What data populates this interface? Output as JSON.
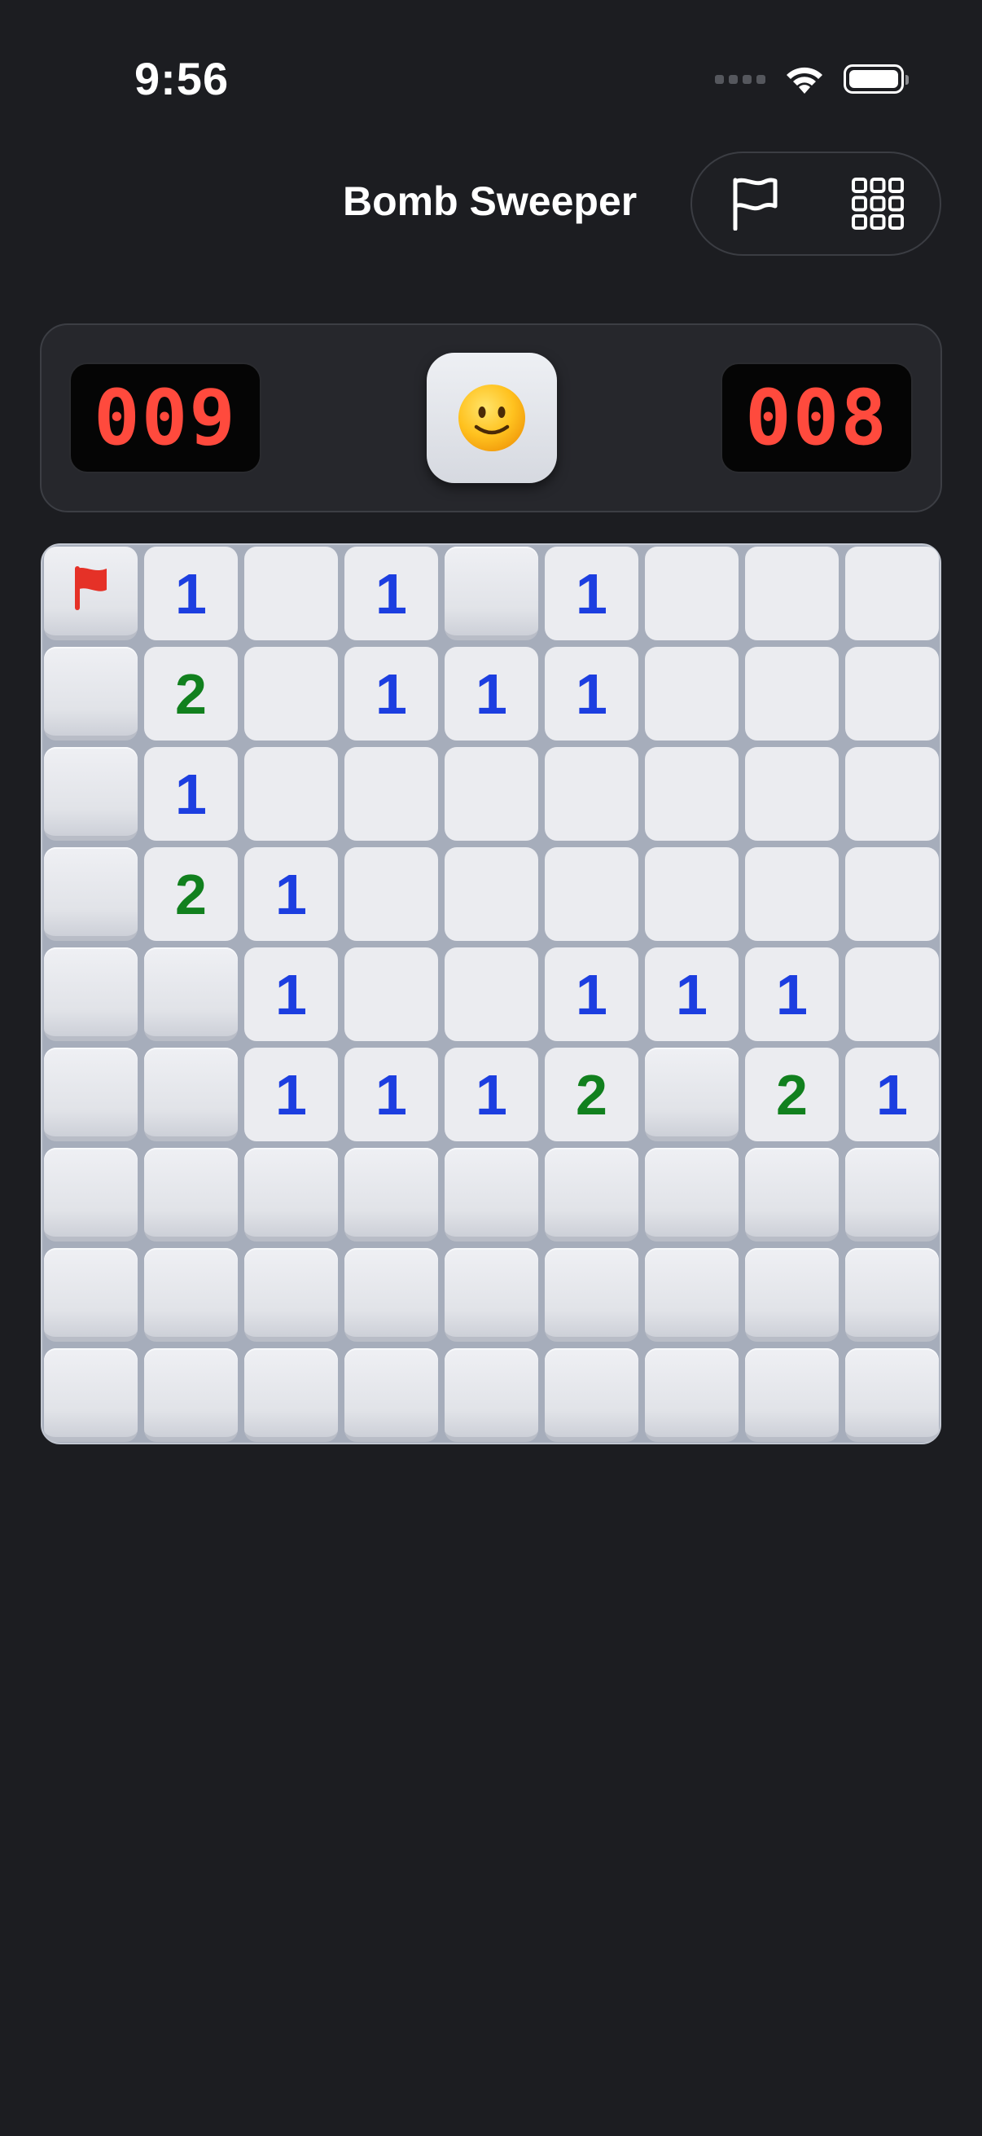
{
  "status_bar": {
    "time": "9:56"
  },
  "nav": {
    "title": "Bomb Sweeper",
    "flag_button_icon": "flag-icon",
    "grid_button_icon": "grid-icon"
  },
  "header": {
    "mines_counter": "009",
    "timer": "008",
    "face": "slightly-smiling-face"
  },
  "colors": {
    "background": "#1c1d21",
    "counter_digits": "#ff4a3d",
    "number_1": "#1c3ee0",
    "number_2": "#11801e",
    "flag": "#e53127"
  },
  "board": {
    "rows": 9,
    "cols": 9,
    "legend": "H = hidden, F = flagged, 0 = revealed empty, digit = revealed number",
    "cells": [
      [
        "F",
        "1",
        "0",
        "1",
        "H",
        "1",
        "0",
        "0",
        "0"
      ],
      [
        "H",
        "2",
        "0",
        "1",
        "1",
        "1",
        "0",
        "0",
        "0"
      ],
      [
        "H",
        "1",
        "0",
        "0",
        "0",
        "0",
        "0",
        "0",
        "0"
      ],
      [
        "H",
        "2",
        "1",
        "0",
        "0",
        "0",
        "0",
        "0",
        "0"
      ],
      [
        "H",
        "H",
        "1",
        "0",
        "0",
        "1",
        "1",
        "1",
        "0"
      ],
      [
        "H",
        "H",
        "1",
        "1",
        "1",
        "2",
        "H",
        "2",
        "1"
      ],
      [
        "H",
        "H",
        "H",
        "H",
        "H",
        "H",
        "H",
        "H",
        "H"
      ],
      [
        "H",
        "H",
        "H",
        "H",
        "H",
        "H",
        "H",
        "H",
        "H"
      ],
      [
        "H",
        "H",
        "H",
        "H",
        "H",
        "H",
        "H",
        "H",
        "H"
      ]
    ]
  }
}
